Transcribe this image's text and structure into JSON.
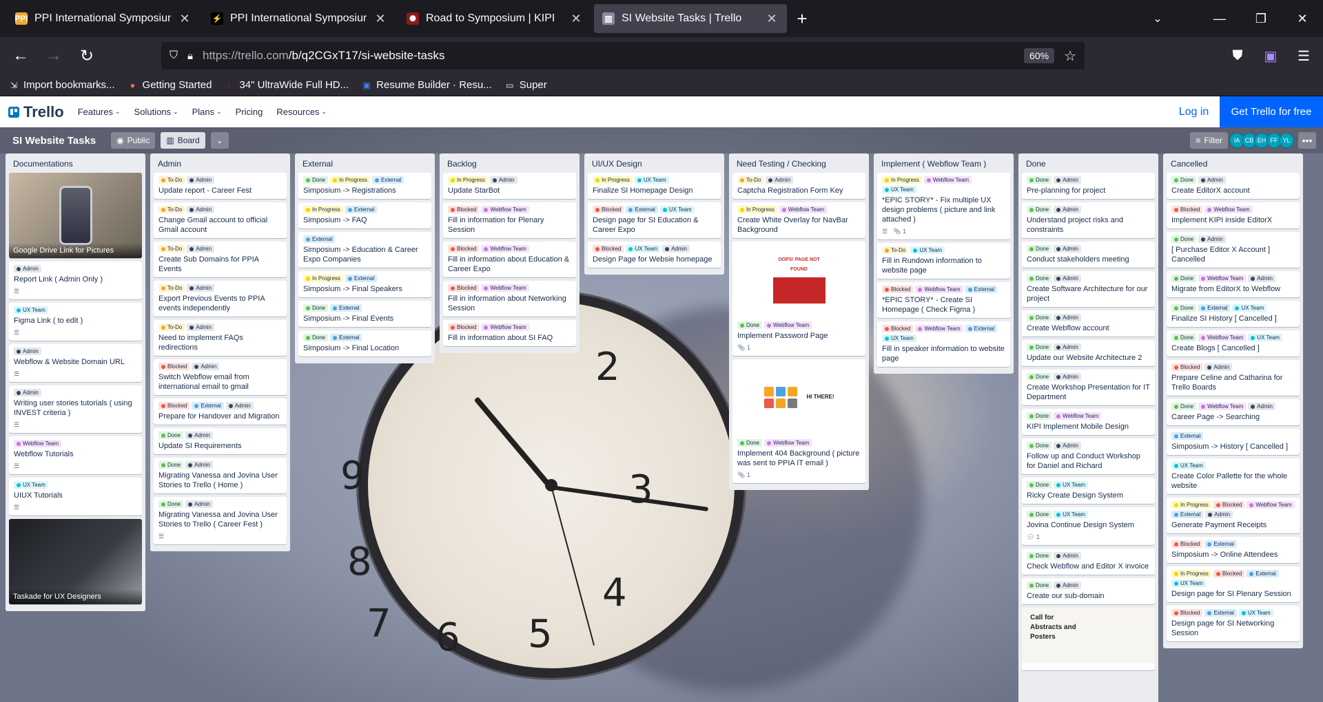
{
  "browser": {
    "tabs": [
      {
        "title": "PPI International Symposium",
        "favicon": "PPI",
        "fav_color": "#f0a830",
        "active": false
      },
      {
        "title": "PPI International Symposium - I",
        "favicon": "⚡",
        "fav_color": "#000000",
        "active": false
      },
      {
        "title": "Road to Symposium | KIPI",
        "favicon": "✺",
        "fav_color": "#8b1a1a",
        "active": false
      },
      {
        "title": "SI Website Tasks | Trello",
        "favicon": "▥",
        "fav_color": "#8a8aa0",
        "active": true
      }
    ],
    "new_tab": "+",
    "url_host": "https://trello.com",
    "url_path": "/b/q2CGxT17/si-website-tasks",
    "zoom": "60%",
    "bookmarks": [
      {
        "label": "Import bookmarks...",
        "icon": "import-icon"
      },
      {
        "label": "Getting Started",
        "icon": "firefox-icon"
      },
      {
        "label": "34\" UltraWide Full HD...",
        "icon": "lg-icon"
      },
      {
        "label": "Resume Builder · Resu...",
        "icon": "resume-icon"
      },
      {
        "label": "Super",
        "icon": "folder-icon"
      }
    ]
  },
  "trello": {
    "logo": "Trello",
    "menu": [
      "Features",
      "Solutions",
      "Plans",
      "Pricing",
      "Resources"
    ],
    "login": "Log in",
    "cta": "Get Trello for free"
  },
  "board": {
    "title": "SI Website Tasks",
    "visibility": "Public",
    "view": "Board",
    "filter": "Filter",
    "members": [
      "IA",
      "CB",
      "EH",
      "FF",
      "YL"
    ]
  },
  "lists": [
    {
      "name": "Documentations",
      "cards": [
        {
          "photo": "phone",
          "title": "Google Drive Link for Pictures"
        },
        {
          "labels": [
            "admin"
          ],
          "title": "Report Link ( Admin Only )",
          "desc": true
        },
        {
          "labels": [
            "ux"
          ],
          "title": "Figma Link ( to edit )",
          "desc": true
        },
        {
          "labels": [
            "admin"
          ],
          "title": "Webflow & Website Domain URL",
          "desc": true
        },
        {
          "labels": [
            "admin"
          ],
          "title": "Writing user stories tutorials ( using INVEST criteria )",
          "desc": true
        },
        {
          "labels": [
            "webflow"
          ],
          "title": "Webflow Tutorials",
          "desc": true
        },
        {
          "labels": [
            "ux"
          ],
          "title": "UIUX Tutorials",
          "desc": true
        },
        {
          "photo": "desk",
          "title": "Taskade for UX Designers"
        }
      ]
    },
    {
      "name": "Admin",
      "cards": [
        {
          "labels": [
            "todo",
            "admin"
          ],
          "title": "Update report - Career Fest"
        },
        {
          "labels": [
            "todo",
            "admin"
          ],
          "title": "Change Gmail account to official Gmail account"
        },
        {
          "labels": [
            "todo",
            "admin"
          ],
          "title": "Create Sub Domains for PPIA Events"
        },
        {
          "labels": [
            "todo",
            "admin"
          ],
          "title": "Export Previous Events to PPIA events independently"
        },
        {
          "labels": [
            "todo",
            "admin"
          ],
          "title": "Need to implement FAQs redirections"
        },
        {
          "labels": [
            "blocked",
            "admin"
          ],
          "title": "Switch Webflow email from international email to gmail"
        },
        {
          "labels": [
            "blocked",
            "external",
            "admin"
          ],
          "title": "Prepare for Handover and Migration"
        },
        {
          "labels": [
            "done",
            "admin"
          ],
          "title": "Update SI Requirements"
        },
        {
          "labels": [
            "done",
            "admin"
          ],
          "title": "Migrating Vanessa and Jovina User Stories to Trello ( Home )"
        },
        {
          "labels": [
            "done",
            "admin"
          ],
          "title": "Migrating Vanessa and Jovina User Stories to Trello ( Career Fest )",
          "desc": true
        }
      ]
    },
    {
      "name": "External",
      "cards": [
        {
          "labels": [
            "done",
            "inprogress",
            "external"
          ],
          "title": "Simposium -> Registrations"
        },
        {
          "labels": [
            "inprogress",
            "external"
          ],
          "title": "Simposium -> FAQ"
        },
        {
          "labels": [
            "external"
          ],
          "title": "Simposium -> Education & Career Expo Companies"
        },
        {
          "labels": [
            "inprogress",
            "external"
          ],
          "title": "Simposium -> Final Speakers"
        },
        {
          "labels": [
            "done",
            "external"
          ],
          "title": "Simposium -> Final Events"
        },
        {
          "labels": [
            "done",
            "external"
          ],
          "title": "Simposium -> Final Location"
        }
      ]
    },
    {
      "name": "Backlog",
      "cards": [
        {
          "labels": [
            "inprogress",
            "admin"
          ],
          "title": "Update StarBot"
        },
        {
          "labels": [
            "blocked",
            "webflow"
          ],
          "title": "Fill in information for Plenary Session"
        },
        {
          "labels": [
            "blocked",
            "webflow"
          ],
          "title": "Fill in information about Education & Career Expo"
        },
        {
          "labels": [
            "blocked",
            "webflow"
          ],
          "title": "Fill in information about Networking Session"
        },
        {
          "labels": [
            "blocked",
            "webflow"
          ],
          "title": "Fill in information about SI FAQ"
        }
      ]
    },
    {
      "name": "UI/UX Design",
      "cards": [
        {
          "labels": [
            "inprogress",
            "ux"
          ],
          "title": "Finalize SI Homepage Design"
        },
        {
          "labels": [
            "blocked",
            "external",
            "ux"
          ],
          "title": "Design page for SI Education & Career Expo"
        },
        {
          "labels": [
            "blocked",
            "ux",
            "admin"
          ],
          "title": "Design Page for Websie homepage"
        }
      ]
    },
    {
      "name": "Need Testing / Checking",
      "cards": [
        {
          "labels": [
            "todo",
            "admin"
          ],
          "title": "Captcha Registration Form Key"
        },
        {
          "labels": [
            "inprogress",
            "webflow"
          ],
          "title": "Create White Overlay for NavBar Background"
        },
        {
          "cover": "404",
          "cover_text": "OOPS! PAGE NOT FOUND",
          "labels": [
            "done",
            "webflow"
          ],
          "title": "Implement Password Page",
          "attachments": "1"
        },
        {
          "cover": "hi",
          "cover_text": "HI THERE!",
          "labels": [
            "done",
            "webflow"
          ],
          "title": "Implement 404 Background ( picture was sent to PPIA IT email )",
          "attachments": "1"
        }
      ]
    },
    {
      "name": "Implement ( Webflow Team )",
      "cards": [
        {
          "labels": [
            "inprogress",
            "webflow",
            "ux"
          ],
          "title": "*EPIC STORY* - Fix multiple UX design problems ( picture and link attached )",
          "desc": true,
          "attachments": "1"
        },
        {
          "labels": [
            "todo",
            "ux"
          ],
          "title": "Fill in Rundown information to website page"
        },
        {
          "labels": [
            "blocked",
            "webflow",
            "external"
          ],
          "title": "*EPIC STORY* - Create SI Homepage ( Check Figma )"
        },
        {
          "labels": [
            "blocked",
            "webflow",
            "external",
            "ux"
          ],
          "title": "Fill in speaker information to website page"
        }
      ]
    },
    {
      "name": "Done",
      "cards": [
        {
          "labels": [
            "done",
            "admin"
          ],
          "title": "Pre-planning for project"
        },
        {
          "labels": [
            "done",
            "admin"
          ],
          "title": "Understand project risks and constraints"
        },
        {
          "labels": [
            "done",
            "admin"
          ],
          "title": "Conduct stakeholders meeting"
        },
        {
          "labels": [
            "done",
            "admin"
          ],
          "title": "Create Software Architecture for our project"
        },
        {
          "labels": [
            "done",
            "admin"
          ],
          "title": "Create Webflow account"
        },
        {
          "labels": [
            "done",
            "admin"
          ],
          "title": "Update our Website Architecture 2"
        },
        {
          "labels": [
            "done",
            "admin"
          ],
          "title": "Create Workshop Presentation for IT Department"
        },
        {
          "labels": [
            "done",
            "webflow"
          ],
          "title": "KIPI Implement Mobile Design"
        },
        {
          "labels": [
            "done",
            "admin"
          ],
          "title": "Follow up and Conduct Workshop for Daniel and Richard"
        },
        {
          "labels": [
            "done",
            "ux"
          ],
          "title": "Ricky Create Design System"
        },
        {
          "labels": [
            "done",
            "ux"
          ],
          "title": "Jovina Continue Design System",
          "comments": "1"
        },
        {
          "labels": [
            "done",
            "admin"
          ],
          "title": "Check Webflow and Editor X invoice"
        },
        {
          "labels": [
            "done",
            "admin"
          ],
          "title": "Create our sub-domain"
        },
        {
          "cover": "poster",
          "cover_text": "Call for Abstracts and Posters"
        }
      ]
    },
    {
      "name": "Cancelled",
      "cards": [
        {
          "labels": [
            "done",
            "admin"
          ],
          "title": "Create EditorX account"
        },
        {
          "labels": [
            "blocked",
            "webflow"
          ],
          "title": "Implement KIPI inside EditorX"
        },
        {
          "labels": [
            "done",
            "admin"
          ],
          "title": "[ Purchase Editor X Account ] Cancelled"
        },
        {
          "labels": [
            "done",
            "webflow",
            "admin"
          ],
          "title": "Migrate from EditorX to Webflow"
        },
        {
          "labels": [
            "done",
            "external",
            "ux"
          ],
          "title": "Finalize SI History [ Cancelled ]"
        },
        {
          "labels": [
            "done",
            "webflow",
            "ux"
          ],
          "title": "Create Blogs [ Cancelled ]"
        },
        {
          "labels": [
            "blocked",
            "admin"
          ],
          "title": "Prepare Celine and Catharina for Trello Boards"
        },
        {
          "labels": [
            "done",
            "webflow",
            "admin"
          ],
          "title": "Career Page -> Searching"
        },
        {
          "labels": [
            "external"
          ],
          "title": "Simposium -> History [ Cancelled ]"
        },
        {
          "labels": [
            "ux"
          ],
          "title": "Create Color Pallette for the whole website"
        },
        {
          "labels": [
            "inprogress",
            "blocked",
            "webflow",
            "external",
            "admin"
          ],
          "title": "Generate Payment Receipts"
        },
        {
          "labels": [
            "blocked",
            "external"
          ],
          "title": "Simposium -> Online Attendees"
        },
        {
          "labels": [
            "inprogress",
            "blocked",
            "external",
            "ux"
          ],
          "title": "Design page for SI Plenary Session"
        },
        {
          "labels": [
            "blocked",
            "external",
            "ux"
          ],
          "title": "Design page for SI Networking Session"
        }
      ]
    }
  ],
  "label_names": {
    "todo": "To-Do",
    "admin": "Admin",
    "done": "Done",
    "inprogress": "In Progress",
    "external": "External",
    "blocked": "Blocked",
    "webflow": "Webflow Team",
    "ux": "UX Team"
  },
  "colors": {
    "trello_blue": "#0065ff",
    "list_bg": "#ebecf0",
    "chrome_bg": "#1c1b22"
  }
}
